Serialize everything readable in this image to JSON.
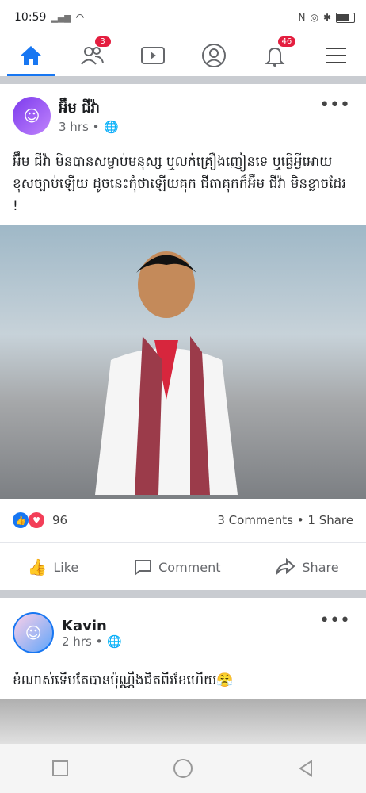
{
  "status_bar": {
    "time": "10:59"
  },
  "nav": {
    "friends_badge": "3",
    "notifications_badge": "46"
  },
  "post1": {
    "author": "អ៊ឹម ជីវ៉ា",
    "time": "3 hrs •",
    "text": "អ៊ឹម ជីវ៉ា មិនបានសម្លាប់មនុស្ស ឬលក់គ្រឿងញៀនទេ ឬធ្វើអ្វីអោយខុសច្បាប់ឡើយ ដូចនេះកុំថាឡើយគុក ជីតាគុកក៏អ៊ឹម ជីវ៉ា មិនខ្លាចដែរ !",
    "reactions_count": "96",
    "comments": "3 Comments",
    "shares": "1 Share"
  },
  "actions": {
    "like": "Like",
    "comment": "Comment",
    "share": "Share"
  },
  "post2": {
    "author": "Kavin",
    "time": "2 hrs •",
    "text": "ខំណាស់ទើបតែបានប៉ុណ្ណឹងជិតពីរខែហើយ😤"
  },
  "colors": {
    "accent": "#1877f2",
    "badge": "#e41e3f"
  }
}
